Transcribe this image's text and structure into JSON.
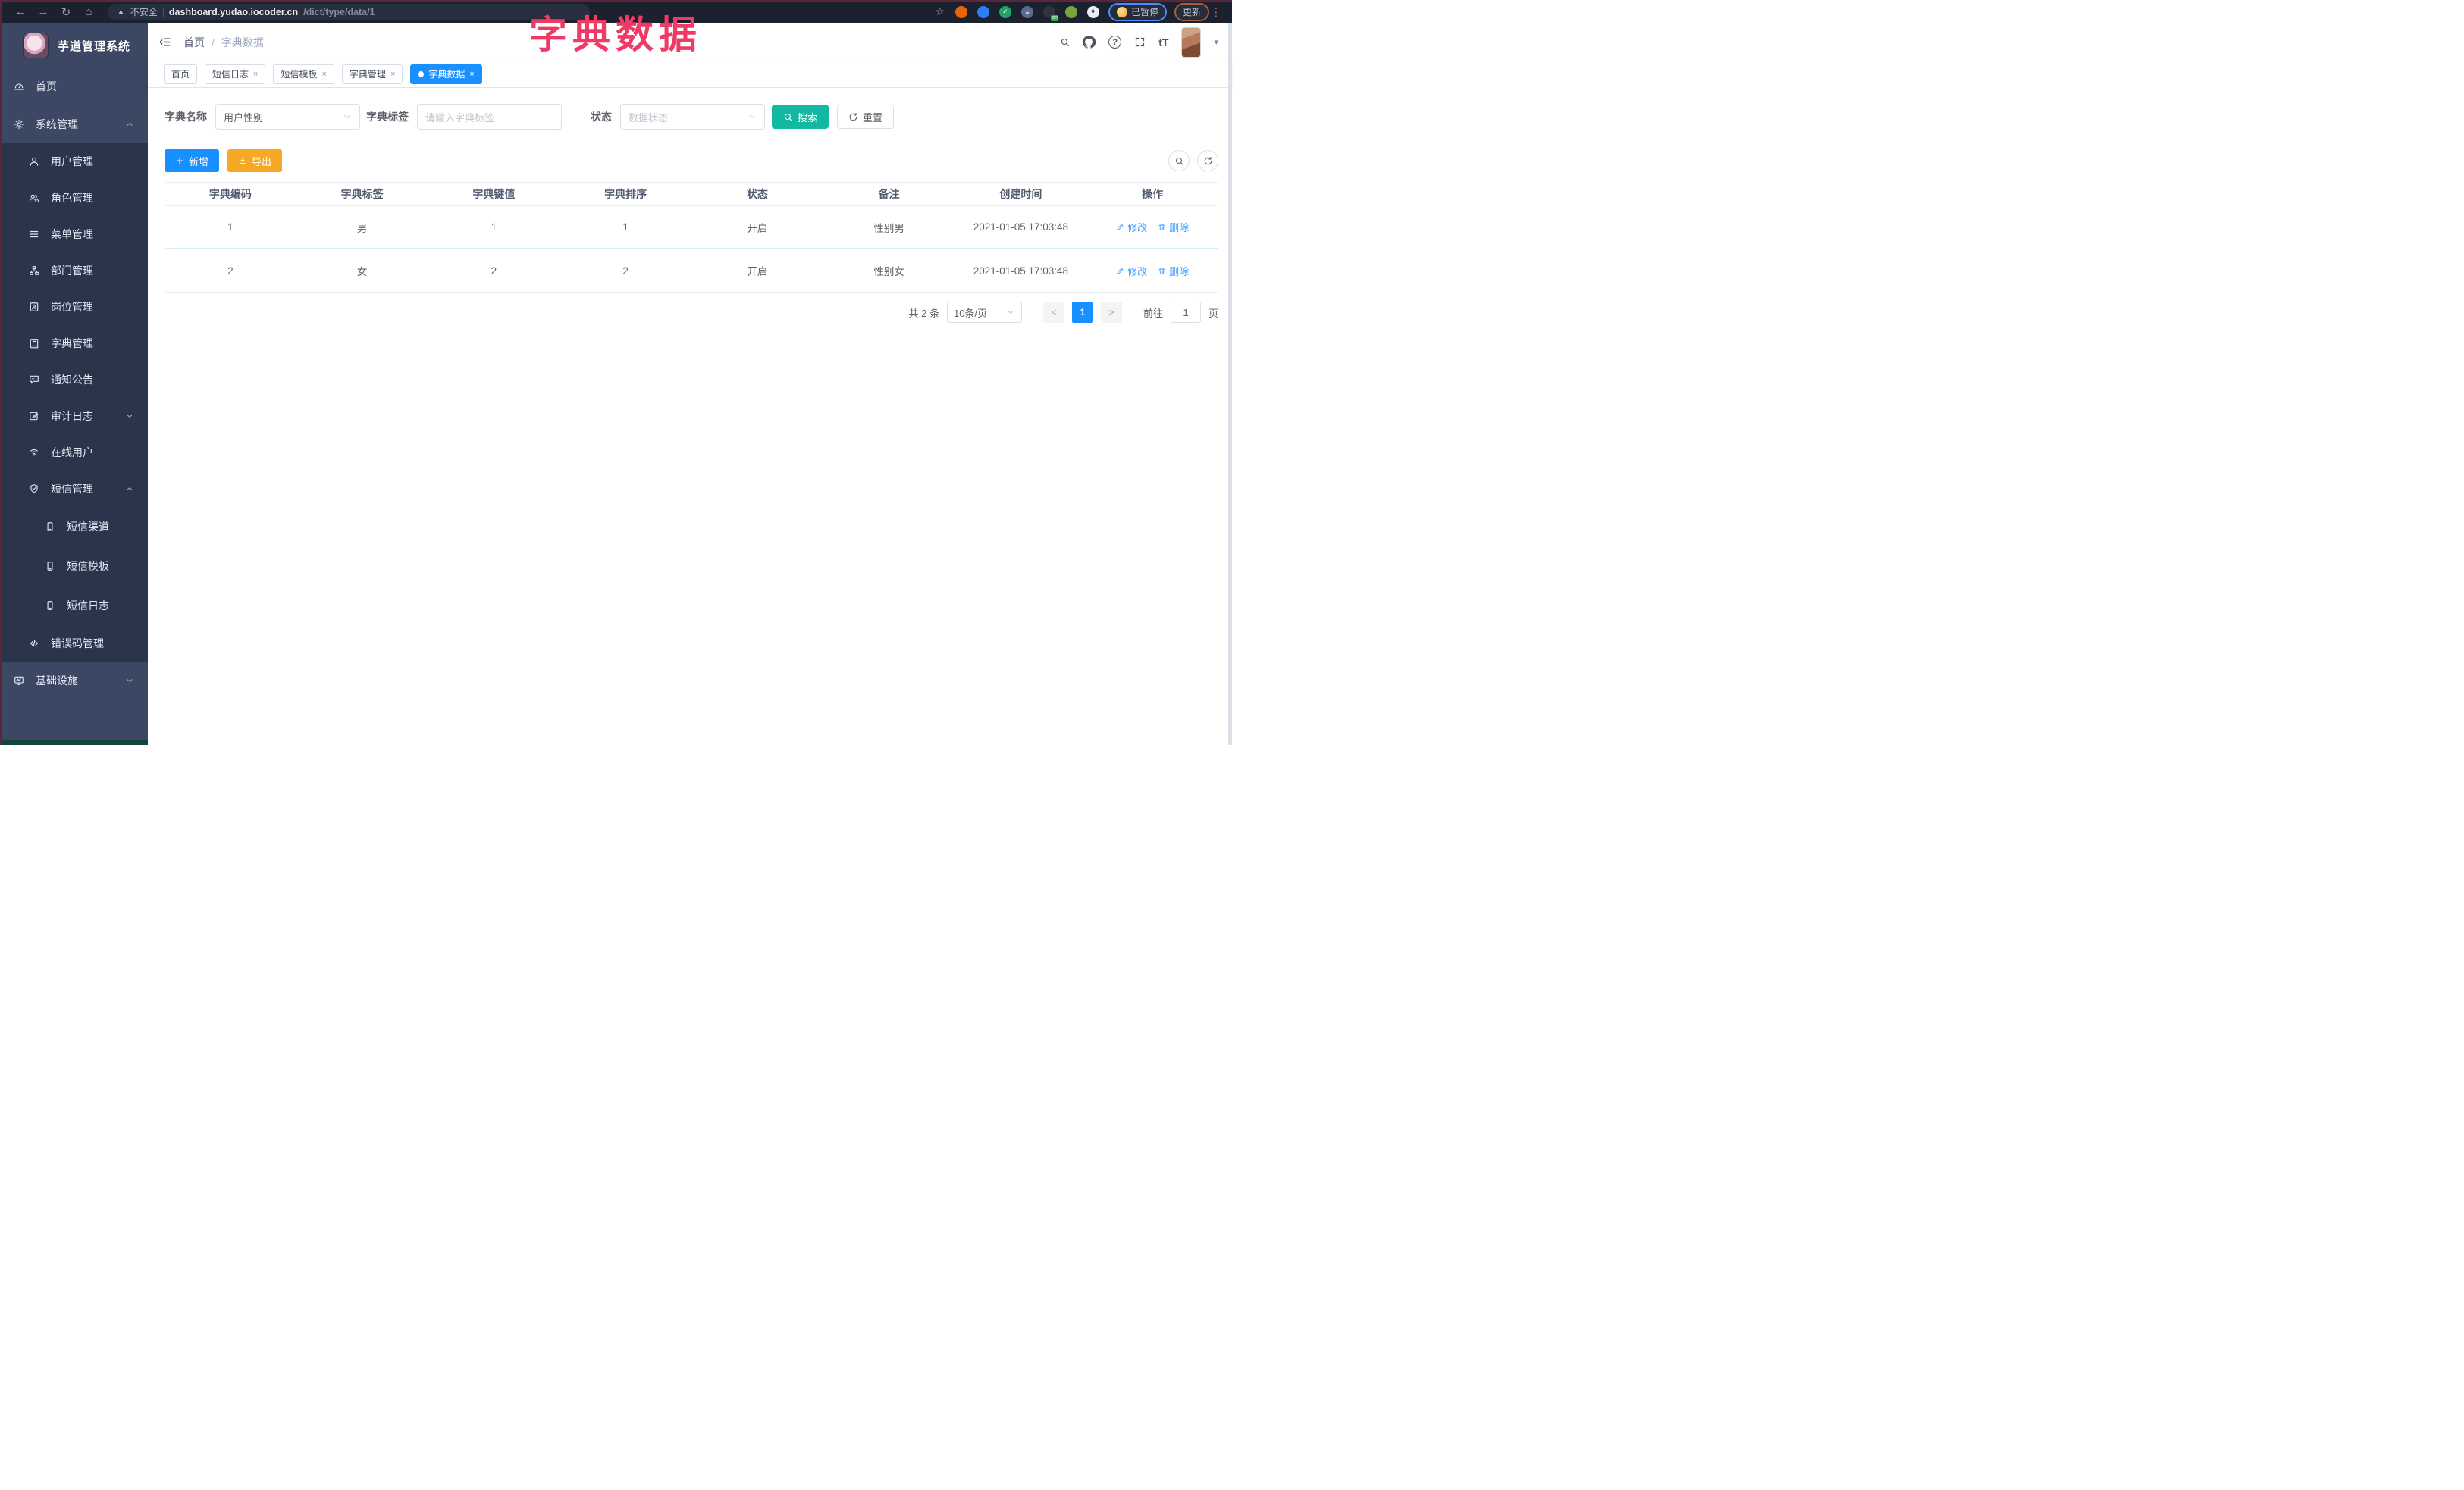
{
  "colors": {
    "primary": "#1890ff",
    "teal": "#13b8a2",
    "orange": "#f6a723",
    "danger_overlay": "#ee3a64",
    "sidebar": "#3b4763",
    "sidebar_sub": "#2a354c",
    "chrome": "#1b212e"
  },
  "overlay_title": "字典数据",
  "browser": {
    "security_label": "不安全",
    "url_host": "dashboard.yudao.iocoder.cn",
    "url_path": "/dict/type/data/1",
    "paused_label": "已暂停",
    "update_label": "更新",
    "extensions": [
      {
        "name": "ext-orange-donut",
        "bg": "#e8630a",
        "text": ""
      },
      {
        "name": "ext-blue-drop",
        "bg": "#2f7df6",
        "text": ""
      },
      {
        "name": "ext-green-check",
        "bg": "#21a366",
        "text": "✓"
      },
      {
        "name": "ext-slate-bars",
        "bg": "#5b6b8c",
        "text": "≡"
      },
      {
        "name": "ext-dark-on",
        "bg": "#30343c",
        "text": "",
        "badge": "on"
      },
      {
        "name": "ext-green-sprout",
        "bg": "#7aa33c",
        "text": ""
      },
      {
        "name": "ext-puzzle",
        "bg": "#e9edf4",
        "text": "✦",
        "fg": "#30343c"
      }
    ]
  },
  "sidebar": {
    "logo_title": "芋道管理系统",
    "items": [
      {
        "label": "首页",
        "icon": "gauge",
        "level": 1,
        "dark": false,
        "chevron": ""
      },
      {
        "label": "系统管理",
        "icon": "gear",
        "level": 1,
        "dark": false,
        "chevron": "up"
      },
      {
        "label": "用户管理",
        "icon": "user",
        "level": 2,
        "dark": true,
        "chevron": ""
      },
      {
        "label": "角色管理",
        "icon": "users",
        "level": 2,
        "dark": true,
        "chevron": ""
      },
      {
        "label": "菜单管理",
        "icon": "list",
        "level": 2,
        "dark": true,
        "chevron": ""
      },
      {
        "label": "部门管理",
        "icon": "tree",
        "level": 2,
        "dark": true,
        "chevron": ""
      },
      {
        "label": "岗位管理",
        "icon": "badge",
        "level": 2,
        "dark": true,
        "chevron": ""
      },
      {
        "label": "字典管理",
        "icon": "book",
        "level": 2,
        "dark": true,
        "chevron": ""
      },
      {
        "label": "通知公告",
        "icon": "announce",
        "level": 2,
        "dark": true,
        "chevron": ""
      },
      {
        "label": "审计日志",
        "icon": "edit-square",
        "level": 2,
        "dark": true,
        "chevron": "down"
      },
      {
        "label": "在线用户",
        "icon": "online",
        "level": 2,
        "dark": true,
        "chevron": ""
      },
      {
        "label": "短信管理",
        "icon": "shield-check",
        "level": 2,
        "dark": true,
        "chevron": "up"
      },
      {
        "label": "短信渠道",
        "icon": "phone",
        "level": 3,
        "dark": true,
        "chevron": ""
      },
      {
        "label": "短信模板",
        "icon": "phone",
        "level": 3,
        "dark": true,
        "chevron": ""
      },
      {
        "label": "短信日志",
        "icon": "phone",
        "level": 3,
        "dark": true,
        "chevron": ""
      },
      {
        "label": "错误码管理",
        "icon": "code",
        "level": 2,
        "dark": true,
        "chevron": ""
      },
      {
        "label": "基础设施",
        "icon": "monitor",
        "level": 1,
        "dark": false,
        "chevron": "down"
      }
    ]
  },
  "header": {
    "breadcrumb": {
      "home": "首页",
      "sep": "/",
      "current": "字典数据"
    },
    "icons": [
      "search",
      "github",
      "question",
      "fullscreen",
      "fontsize"
    ]
  },
  "tabbar": {
    "tabs": [
      {
        "label": "首页",
        "closable": false,
        "active": false
      },
      {
        "label": "短信日志",
        "closable": true,
        "active": false
      },
      {
        "label": "短信模板",
        "closable": true,
        "active": false
      },
      {
        "label": "字典管理",
        "closable": true,
        "active": false
      },
      {
        "label": "字典数据",
        "closable": true,
        "active": true
      }
    ],
    "close_glyph": "×"
  },
  "filters": {
    "name_label": "字典名称",
    "name_value": "用户性别",
    "tag_label": "字典标签",
    "tag_placeholder": "请输入字典标签",
    "status_label": "状态",
    "status_placeholder": "数据状态",
    "search_label": "搜索",
    "reset_label": "重置"
  },
  "toolbar": {
    "add_label": "新增",
    "export_label": "导出"
  },
  "table": {
    "columns": [
      "字典编码",
      "字典标签",
      "字典键值",
      "字典排序",
      "状态",
      "备注",
      "创建时间",
      "操作"
    ],
    "rows": [
      {
        "cells": [
          "1",
          "男",
          "1",
          "1",
          "开启",
          "性别男",
          "2021-01-05 17:03:48"
        ]
      },
      {
        "cells": [
          "2",
          "女",
          "2",
          "2",
          "开启",
          "性别女",
          "2021-01-05 17:03:48"
        ]
      }
    ],
    "action_edit": "修改",
    "action_delete": "删除"
  },
  "pagination": {
    "total_text": "共 2 条",
    "page_size": "10条/页",
    "prev": "<",
    "page": "1",
    "next": ">",
    "goto_label": "前往",
    "goto_value": "1",
    "goto_suffix": "页"
  }
}
